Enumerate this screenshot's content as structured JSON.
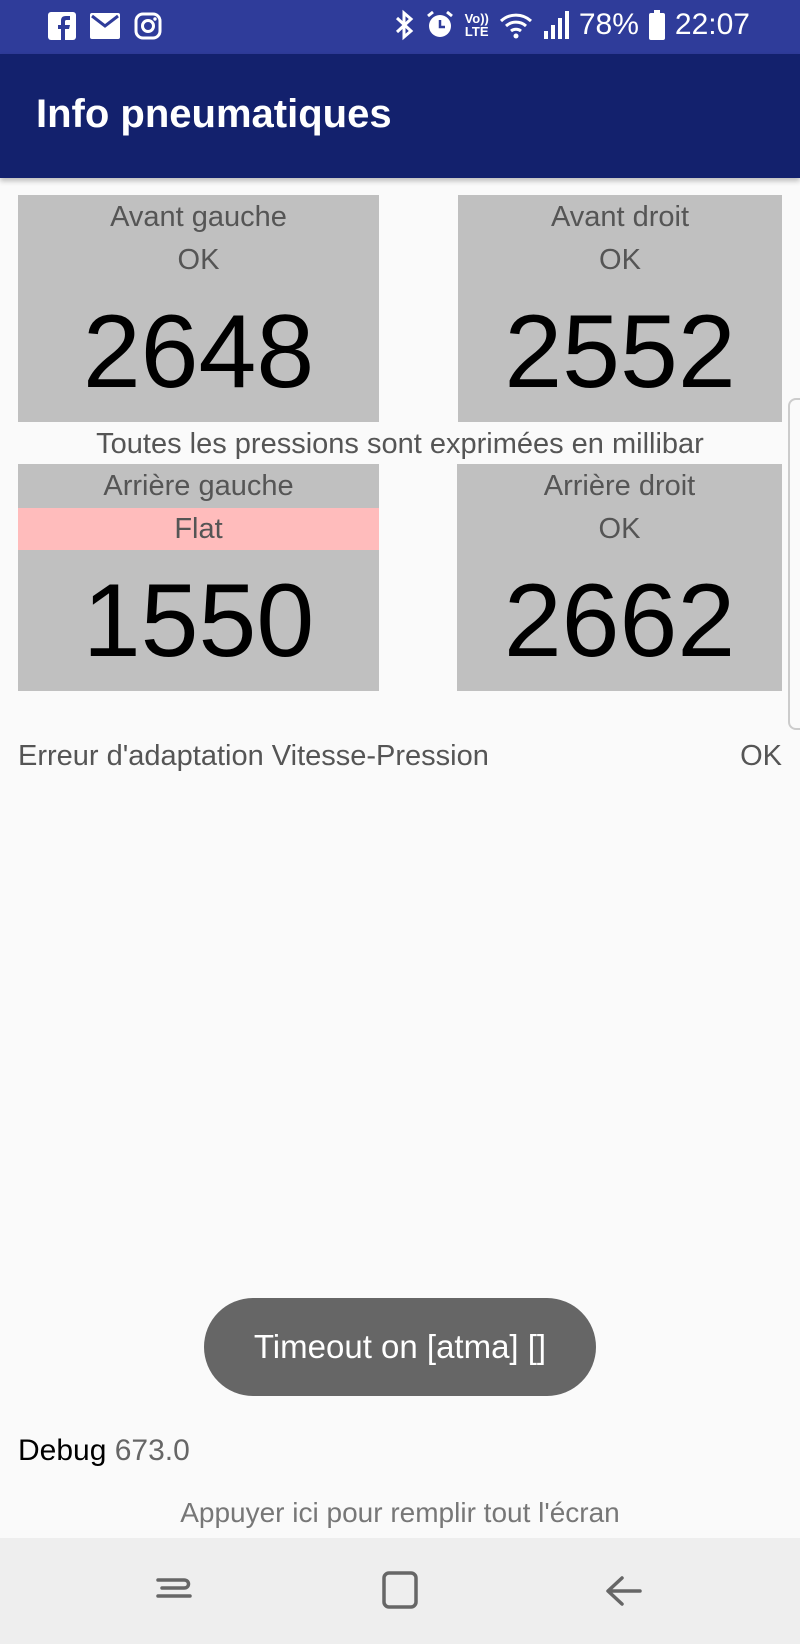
{
  "status_bar": {
    "battery": "78%",
    "time": "22:07",
    "left_icons": [
      "facebook-icon",
      "mail-icon",
      "instagram-icon"
    ],
    "right_icons": [
      "bluetooth-icon",
      "alarm-icon",
      "volte-icon",
      "wifi-icon",
      "signal-icon",
      "battery-icon"
    ],
    "volte_top": "Vo))",
    "volte_bottom": "LTE"
  },
  "app_bar": {
    "title": "Info pneumatiques"
  },
  "tires": {
    "front_left": {
      "name": "Avant gauche",
      "status": "OK",
      "value": "2648"
    },
    "front_right": {
      "name": "Avant droit",
      "status": "OK",
      "value": "2552"
    },
    "rear_left": {
      "name": "Arrière gauche",
      "status": "Flat",
      "value": "1550"
    },
    "rear_right": {
      "name": "Arrière droit",
      "status": "OK",
      "value": "2662"
    }
  },
  "unit_note": "Toutes les pressions sont exprimées en millibar",
  "adaptation": {
    "label": "Erreur d'adaptation Vitesse-Pression",
    "status": "OK"
  },
  "toast": "Timeout on [atma] []",
  "debug": {
    "label": "Debug",
    "value": "673.0"
  },
  "fill_screen_hint": "Appuyer ici pour remplir tout l'écran",
  "colors": {
    "status_bar": "#2f3c9a",
    "app_bar": "#13216d",
    "tile": "#c0c0c0",
    "flat_highlight": "#ffbcbc",
    "toast": "#666666"
  }
}
